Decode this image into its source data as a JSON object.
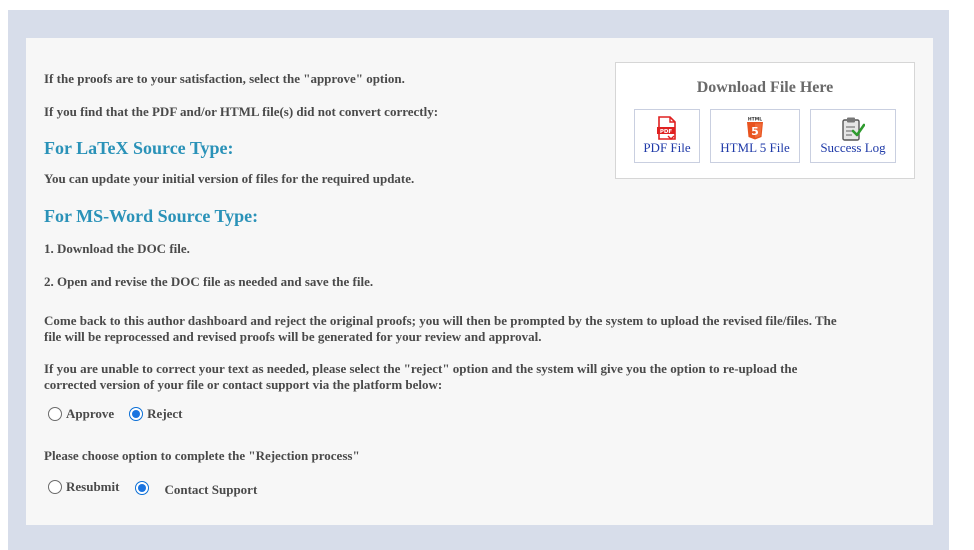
{
  "intro": {
    "approve_text": "If the proofs are to your satisfaction, select the \"approve\" option.",
    "not_convert_text": "If you find that the PDF and/or HTML file(s) did not convert correctly:"
  },
  "latex": {
    "heading": "For LaTeX Source Type:",
    "text": "You can update your initial version of files for the required update."
  },
  "msword": {
    "heading": "For MS-Word Source Type:",
    "step1": "1. Download the DOC file.",
    "step2": "2. Open and revise the DOC file as needed and save the file.",
    "para1_line1": "Come back to this author dashboard and reject the original proofs; you will then be prompted by the system to upload the revised file/files. The",
    "para1_line2": "file will be reprocessed and revised proofs will be generated for your review and approval.",
    "para2_line1": "If you are unable to correct your text as needed, please select the \"reject\" option and the system will give you the option to re-upload the",
    "para2_line2": "corrected version of your file or contact support via the platform below:"
  },
  "decision": {
    "approve_label": "Approve",
    "reject_label": "Reject",
    "selected": "Reject"
  },
  "rejection": {
    "prompt": "Please choose option to complete the \"Rejection process\"",
    "resubmit_label": "Resubmit",
    "contact_label": "Contact Support",
    "selected": "Contact Support"
  },
  "download": {
    "title": "Download File Here",
    "pdf_label": "PDF File",
    "html_label": "HTML 5 File",
    "log_label": "Success Log",
    "pdf_icon_text": "PDF",
    "html_icon_text": "HTML",
    "html_icon_num": "5"
  },
  "colors": {
    "accent_heading": "#2a92b8",
    "link": "#1f3aa8",
    "radio_selected": "#1a74e0",
    "outer_bg": "#d7ddea",
    "pdf_red": "#e02020",
    "html_orange": "#e8531f"
  }
}
